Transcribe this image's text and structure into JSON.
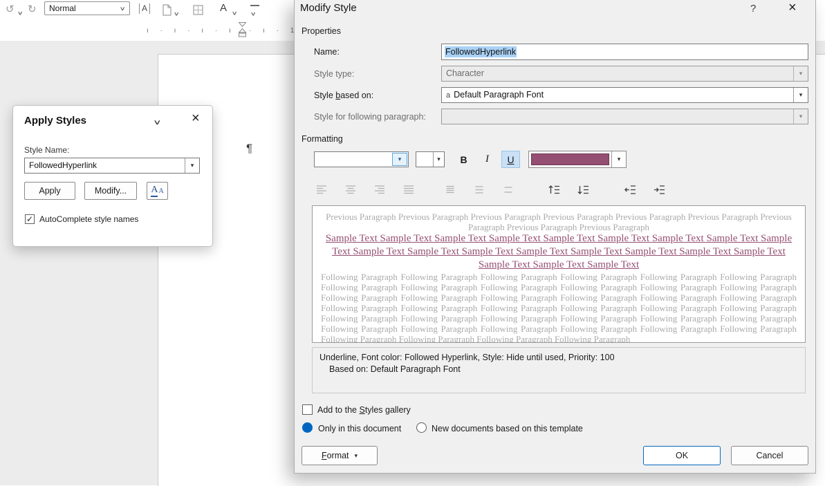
{
  "colors": {
    "accent": "#0067c0",
    "followed_hyperlink": "#954F72",
    "selection_highlight": "#a9d1f5",
    "preview_gray": "#a9a9a9",
    "dialog_background": "#f0f0f0"
  },
  "toolbar": {
    "style_box_value": "Normal"
  },
  "ruler": {
    "left_marks": "ı · ı · ı · ı ·",
    "right_marks": "· ı · 1 · ı ·"
  },
  "document": {
    "pilcrow": "¶"
  },
  "icons": {
    "undo": "↺",
    "redo": "↻",
    "chevron": "∨",
    "combo_arrow": "▾",
    "close": "×",
    "help": "?",
    "check": "✓",
    "char_border": "A",
    "text_effects": "A",
    "styles_pane_big": "A",
    "styles_pane_small": "A",
    "style_icon_a": "a"
  },
  "apply_styles": {
    "title": "Apply Styles",
    "style_name_label": "Style Name:",
    "style_name_value": "FollowedHyperlink",
    "apply_button": "Apply",
    "modify_button": "Modify...",
    "autocomplete_label": "AutoComplete style names"
  },
  "modify_style": {
    "title": "Modify Style",
    "properties_section": "Properties",
    "name_label": "Name:",
    "name_value": "FollowedHyperlink",
    "style_type_label": "Style type:",
    "style_type_value": "Character",
    "based_on_label_pre": "Style ",
    "based_on_label_mn": "b",
    "based_on_label_post": "ased on:",
    "based_on_value": "Default Paragraph Font",
    "following_label": "Style for following paragraph:",
    "following_value": "",
    "formatting_section": "Formatting",
    "font_name_value": "",
    "font_size_value": "",
    "bold_label": "B",
    "italic_label": "I",
    "underline_label": "U",
    "font_color": "#954F72",
    "swatch_style": "background:#954F72",
    "sample_style": "color:#954F72;text-decoration:underline",
    "preview": {
      "previous": "Previous Paragraph Previous Paragraph Previous Paragraph Previous Paragraph Previous Paragraph Previous Paragraph Previous Paragraph Previous Paragraph Previous Paragraph",
      "sample": "Sample Text Sample Text Sample Text Sample Text Sample Text Sample Text Sample Text Sample Text Sample Text Sample Text Sample Text Sample Text Sample Text Sample Text Sample Text Sample Text Sample Text Sample Text Sample Text Sample Text",
      "following": "Following Paragraph Following Paragraph Following Paragraph Following Paragraph Following Paragraph Following Paragraph Following Paragraph Following Paragraph Following Paragraph Following Paragraph Following Paragraph Following Paragraph Following Paragraph Following Paragraph Following Paragraph Following Paragraph Following Paragraph Following Paragraph Following Paragraph Following Paragraph Following Paragraph Following Paragraph Following Paragraph Following Paragraph Following Paragraph Following Paragraph Following Paragraph Following Paragraph Following Paragraph Following Paragraph Following Paragraph Following Paragraph Following Paragraph Following Paragraph Following Paragraph Following Paragraph Following Paragraph Following Paragraph Following Paragraph Following Paragraph"
    },
    "description_line1": "Underline, Font color: Followed Hyperlink, Style: Hide until used, Priority: 100",
    "description_line2": "Based on: Default Paragraph Font",
    "gallery_label_pre": "Add to the ",
    "gallery_label_mn": "S",
    "gallery_label_post": "tyles gallery",
    "only_document_label": "Only in this document",
    "new_documents_label": "New documents based on this template",
    "format_button_mn": "F",
    "format_button_rest": "ormat",
    "ok_button": "OK",
    "cancel_button": "Cancel"
  }
}
